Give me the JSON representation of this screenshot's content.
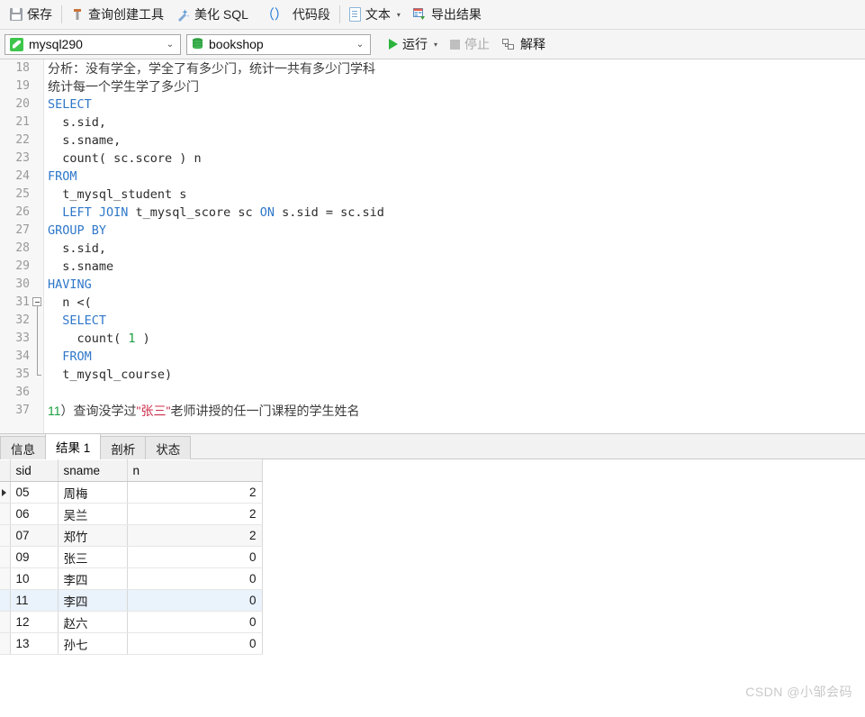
{
  "toolbar": {
    "items": [
      {
        "label": "保存",
        "icon": "save-icon"
      },
      {
        "label": "查询创建工具",
        "icon": "query-builder-icon"
      },
      {
        "label": "美化 SQL",
        "icon": "beautify-sql-icon"
      },
      {
        "label": "代码段",
        "icon": "code-snippet-icon"
      },
      {
        "label": "文本",
        "icon": "text-icon",
        "caret": "▾"
      },
      {
        "label": "导出结果",
        "icon": "export-result-icon"
      }
    ]
  },
  "connbar": {
    "connection": {
      "value": "mysql290",
      "icon": "mysql-icon",
      "chevron": "⌄"
    },
    "database": {
      "value": "bookshop",
      "icon": "database-icon",
      "chevron": "⌄"
    },
    "run": {
      "label": "运行",
      "icon": "play-icon",
      "caret": "▾"
    },
    "stop": {
      "label": "停止",
      "icon": "stop-icon"
    },
    "explain": {
      "label": "解释",
      "icon": "explain-icon"
    }
  },
  "editor": {
    "lines": [
      {
        "num": "18",
        "fold": "none",
        "segments": [
          {
            "t": "comment-cn",
            "v": "分析：没有学全，学全了有多少门，统计一共有多少门学科"
          }
        ]
      },
      {
        "num": "19",
        "fold": "none",
        "segments": [
          {
            "t": "comment-cn",
            "v": "统计每一个学生学了多少门"
          }
        ]
      },
      {
        "num": "20",
        "fold": "none",
        "segments": [
          {
            "t": "kw",
            "v": "SELECT"
          }
        ]
      },
      {
        "num": "21",
        "fold": "none",
        "segments": [
          {
            "t": "plain",
            "v": "  s.sid,"
          }
        ]
      },
      {
        "num": "22",
        "fold": "none",
        "segments": [
          {
            "t": "plain",
            "v": "  s.sname,"
          }
        ]
      },
      {
        "num": "23",
        "fold": "none",
        "segments": [
          {
            "t": "plain",
            "v": "  count( sc.score ) n"
          }
        ]
      },
      {
        "num": "24",
        "fold": "none",
        "segments": [
          {
            "t": "kw",
            "v": "FROM"
          }
        ]
      },
      {
        "num": "25",
        "fold": "none",
        "segments": [
          {
            "t": "plain",
            "v": "  t_mysql_student s"
          }
        ]
      },
      {
        "num": "26",
        "fold": "none",
        "segments": [
          {
            "t": "plain",
            "v": "  "
          },
          {
            "t": "kw",
            "v": "LEFT JOIN"
          },
          {
            "t": "plain",
            "v": " t_mysql_score sc "
          },
          {
            "t": "kw",
            "v": "ON"
          },
          {
            "t": "plain",
            "v": " s.sid = sc.sid"
          }
        ]
      },
      {
        "num": "27",
        "fold": "none",
        "segments": [
          {
            "t": "kw",
            "v": "GROUP BY"
          }
        ]
      },
      {
        "num": "28",
        "fold": "none",
        "segments": [
          {
            "t": "plain",
            "v": "  s.sid,"
          }
        ]
      },
      {
        "num": "29",
        "fold": "none",
        "segments": [
          {
            "t": "plain",
            "v": "  s.sname"
          }
        ]
      },
      {
        "num": "30",
        "fold": "none",
        "segments": [
          {
            "t": "kw",
            "v": "HAVING"
          }
        ]
      },
      {
        "num": "31",
        "fold": "start",
        "segments": [
          {
            "t": "plain",
            "v": "  n <("
          }
        ]
      },
      {
        "num": "32",
        "fold": "mid",
        "segments": [
          {
            "t": "kw",
            "v": "  SELECT"
          }
        ]
      },
      {
        "num": "33",
        "fold": "mid",
        "segments": [
          {
            "t": "plain",
            "v": "    count( "
          },
          {
            "t": "num",
            "v": "1"
          },
          {
            "t": "plain",
            "v": " )"
          }
        ]
      },
      {
        "num": "34",
        "fold": "mid",
        "segments": [
          {
            "t": "kw",
            "v": "  FROM"
          }
        ]
      },
      {
        "num": "35",
        "fold": "end",
        "segments": [
          {
            "t": "plain",
            "v": "  t_mysql_course)"
          }
        ]
      },
      {
        "num": "36",
        "fold": "none",
        "segments": []
      },
      {
        "num": "37",
        "fold": "none",
        "segments": [
          {
            "t": "num-cn",
            "v": "11"
          },
          {
            "t": "comment-cn",
            "v": "）查询没学过"
          },
          {
            "t": "str-cn",
            "v": "\"张三\""
          },
          {
            "t": "comment-cn",
            "v": "老师讲授的任一门课程的学生姓名"
          }
        ]
      }
    ]
  },
  "result": {
    "tabs": [
      {
        "label": "信息",
        "active": false
      },
      {
        "label": "结果 1",
        "active": true
      },
      {
        "label": "剖析",
        "active": false
      },
      {
        "label": "状态",
        "active": false
      }
    ],
    "columns": [
      "sid",
      "sname",
      "n"
    ],
    "rows": [
      {
        "sid": "05",
        "sname": "周梅",
        "n": "2",
        "current": true,
        "alt": false
      },
      {
        "sid": "06",
        "sname": "吴兰",
        "n": "2",
        "current": false,
        "alt": false
      },
      {
        "sid": "07",
        "sname": "郑竹",
        "n": "2",
        "current": false,
        "alt": true
      },
      {
        "sid": "09",
        "sname": "张三",
        "n": "0",
        "current": false,
        "alt": false
      },
      {
        "sid": "10",
        "sname": "李四",
        "n": "0",
        "current": false,
        "alt": false
      },
      {
        "sid": "11",
        "sname": "李四",
        "n": "0",
        "current": false,
        "alt": false,
        "selected": true
      },
      {
        "sid": "12",
        "sname": "赵六",
        "n": "0",
        "current": false,
        "alt": false
      },
      {
        "sid": "13",
        "sname": "孙七",
        "n": "0",
        "current": false,
        "alt": false
      }
    ]
  },
  "watermark": {
    "text": "CSDN @小邹会码"
  }
}
